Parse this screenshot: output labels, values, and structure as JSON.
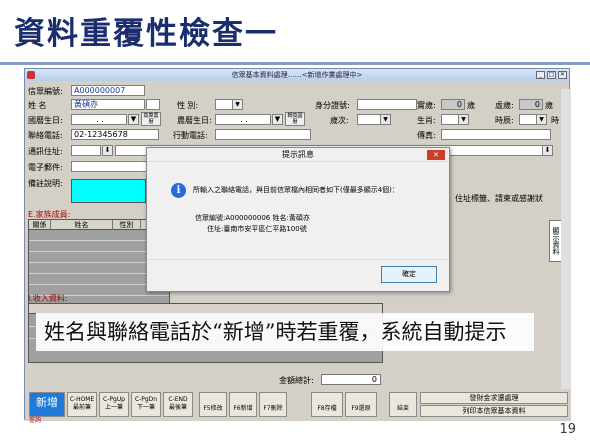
{
  "slide": {
    "title": "資料重覆性檢查一",
    "page_number": "19"
  },
  "window": {
    "title": "信眾基本資料處理……<新增作業處理中>"
  },
  "form": {
    "member_no_label": "信眾編號:",
    "member_no": "A000000007",
    "name_label": "姓  名",
    "name": "黃碩亦",
    "gender_label": "性  別:",
    "id_label": "身分證號:",
    "age_label": "實歲:",
    "age_value": "0",
    "age_unit": "歲",
    "virtual_age_label": "虛歲:",
    "virtual_age_value": "0",
    "virtual_age_unit": "歲",
    "birthday_label": "國曆生日:",
    "birthday_dots": ". .",
    "convert_btn": "換算農曆",
    "lunar_birthday_label": "農曆生日:",
    "lunar_dots": ". .",
    "convert_btn2": "轉換國曆",
    "year_label": "歲次:",
    "zodiac_label": "生肖:",
    "hour_label": "時辰:",
    "hour_unit": "時",
    "phone_label": "聯絡電話:",
    "phone": "02-12345678",
    "mobile_label": "行動電話:",
    "fax_label": "傳真:",
    "address_label": "通訊住址:",
    "email_label": "電子郵件:",
    "note_label": "備註說明:",
    "family_section": "E.家族成員:",
    "income_section": "I.收入資料:",
    "family_cols": [
      "關係",
      "姓名",
      "性別"
    ],
    "right_note": "住址標籤、請柬或感謝狀",
    "right_tab": "顯示資料",
    "total_label": "金額總計:",
    "total_value": "0"
  },
  "dialog": {
    "title": "提示訊息",
    "close": "✕",
    "icon": "info-icon",
    "message": "所輸入之聯絡電話，與目前信眾檔內相同者如下(僅最多顯示4個)：",
    "detail_line1": "信眾編號:A000000006 姓名:黃碩亦",
    "detail_line2": "住址:臺南市安平區仁平路100號",
    "ok": "確定"
  },
  "caption": "姓名與聯絡電話於“新增”時若重覆，系統自動提示",
  "toolbar": {
    "new": "新增",
    "home": [
      "C-HOME",
      "最前筆"
    ],
    "pgup": [
      "C-PgUp",
      "上一筆"
    ],
    "pgdn": [
      "C-PgDn",
      "下一筆"
    ],
    "end": [
      "C-END",
      "最後筆"
    ],
    "f5": "F5修改",
    "f6": "F6新增",
    "f7": "F7刪除",
    "f8": "F8存檔",
    "f9": "F9還原",
    "close": "結束",
    "r1": "發財金求還處理",
    "r2": "列印本信眾基本資料",
    "query": "查詢"
  }
}
